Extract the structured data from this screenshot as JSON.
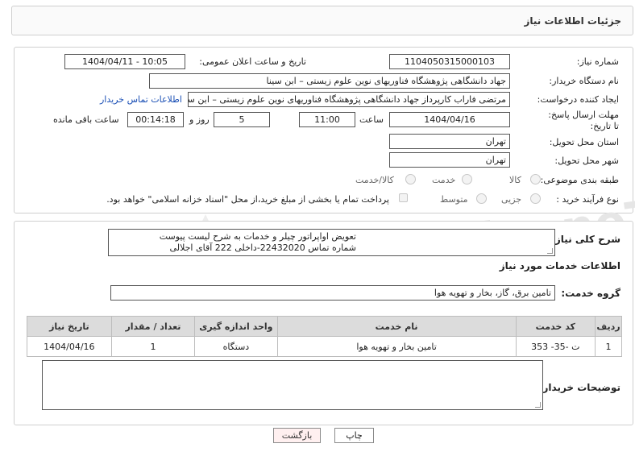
{
  "header": {
    "title": "جزئیات اطلاعات نیاز"
  },
  "form": {
    "need_number_label": "شماره نیاز:",
    "need_number": "1104050315000103",
    "announce_datetime_label": "تاریخ و ساعت اعلان عمومی:",
    "announce_datetime": "1404/04/11 - 10:05",
    "buyer_org_label": "نام دستگاه خریدار:",
    "buyer_org": "جهاد دانشگاهی پژوهشگاه فناوریهای نوین علوم زیستی – ابن سینا",
    "requester_label": "ایجاد کننده درخواست:",
    "requester": "مرتضی فاراب کارپرداز جهاد دانشگاهی پژوهشگاه فناوریهای نوین علوم زیستی – ابن سینا",
    "buyer_contact_link": "اطلاعات تماس خریدار",
    "deadline_label": "مهلت ارسال پاسخ: تا تاریخ:",
    "deadline_date": "1404/04/16",
    "time_label": "ساعت",
    "deadline_time": "11:00",
    "days_value": "5",
    "days_label": "روز و",
    "remaining_time": "00:14:18",
    "remaining_label": "ساعت باقی مانده",
    "province_label": "استان محل تحویل:",
    "province": "تهران",
    "city_label": "شهر محل تحویل:",
    "city": "تهران",
    "category_label": "طبقه بندی موضوعی:",
    "category_options": [
      "کالا",
      "خدمت",
      "کالا/خدمت"
    ],
    "process_label": "نوع فرآیند خرید :",
    "process_options": [
      "جزیی",
      "متوسط"
    ],
    "payment_note": "پرداخت تمام یا بخشی از مبلغ خرید،از محل \"اسناد خزانه اسلامی\" خواهد بود."
  },
  "description": {
    "label": "شرح کلی نیاز:",
    "line1": "تعویض اواپراتور چیلر و خدمات به شرح لیست پیوست",
    "line2": "شماره تماس 22432020-داخلی 222 آقای اجلالی"
  },
  "services": {
    "section_title": "اطلاعات خدمات مورد نیاز",
    "group_label": "گروه خدمت:",
    "group_value": "تامین برق، گاز، بخار و تهویه هوا",
    "columns": [
      "ردیف",
      "کد خدمت",
      "نام خدمت",
      "واحد اندازه گیری",
      "تعداد / مقدار",
      "تاریخ نیاز"
    ],
    "rows": [
      {
        "index": "1",
        "code": "ت -35- 353",
        "name": "تامین بخار و تهویه هوا",
        "unit": "دستگاه",
        "qty": "1",
        "date": "1404/04/16"
      }
    ]
  },
  "buyer_notes": {
    "label": "توضیحات خریدار:",
    "value": ""
  },
  "buttons": {
    "print": "چاپ",
    "back": "بازگشت"
  },
  "watermark": "AriaTender.neT"
}
